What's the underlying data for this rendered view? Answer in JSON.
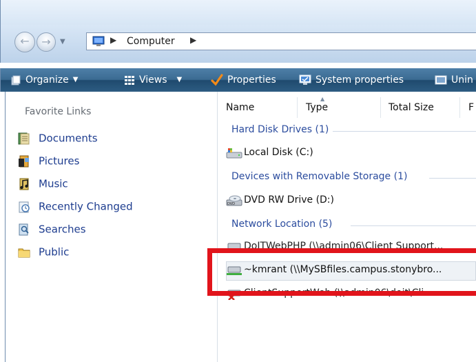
{
  "address_bar": {
    "segments": [
      "Computer"
    ],
    "location_icon": "computer-icon"
  },
  "toolbar": {
    "items": [
      {
        "label": "Organize",
        "icon": "organize-icon",
        "has_dropdown": true
      },
      {
        "label": "Views",
        "icon": "views-icon",
        "has_dropdown": true
      },
      {
        "label": "Properties",
        "icon": "checkmark-icon",
        "has_dropdown": false
      },
      {
        "label": "System properties",
        "icon": "system-properties-icon",
        "has_dropdown": false
      },
      {
        "label": "Unin",
        "icon": "uninstall-icon",
        "has_dropdown": false
      }
    ]
  },
  "favorite_links": {
    "title": "Favorite Links",
    "items": [
      {
        "label": "Documents",
        "icon": "documents-icon"
      },
      {
        "label": "Pictures",
        "icon": "pictures-icon"
      },
      {
        "label": "Music",
        "icon": "music-icon"
      },
      {
        "label": "Recently Changed",
        "icon": "recently-changed-icon"
      },
      {
        "label": "Searches",
        "icon": "searches-icon"
      },
      {
        "label": "Public",
        "icon": "public-folder-icon"
      }
    ]
  },
  "columns": [
    "Name",
    "Type",
    "Total Size",
    "F"
  ],
  "sort_column": "Type",
  "groups": [
    {
      "label": "Hard Disk Drives (1)",
      "items": [
        {
          "label": "Local Disk (C:)",
          "icon": "local-disk-icon"
        }
      ]
    },
    {
      "label": "Devices with Removable Storage (1)",
      "items": [
        {
          "label": "DVD RW Drive (D:)",
          "icon": "dvd-drive-icon"
        }
      ]
    },
    {
      "label": "Network Location (5)",
      "items": [
        {
          "label": "DoITWebPHP (\\\\admin06\\Client Support...",
          "icon": "network-drive-icon"
        },
        {
          "label": "~kmrant (\\\\MySBfiles.campus.stonybro...",
          "icon": "network-drive-icon"
        },
        {
          "label": "ClientSupportWeb (\\\\admin06\\doit\\Cli...",
          "icon": "disconnected-network-drive-icon"
        }
      ]
    }
  ],
  "highlight": {
    "color": "#e1141b",
    "target": "~kmrant (\\\\MySBfiles.campus.stonybro..."
  }
}
